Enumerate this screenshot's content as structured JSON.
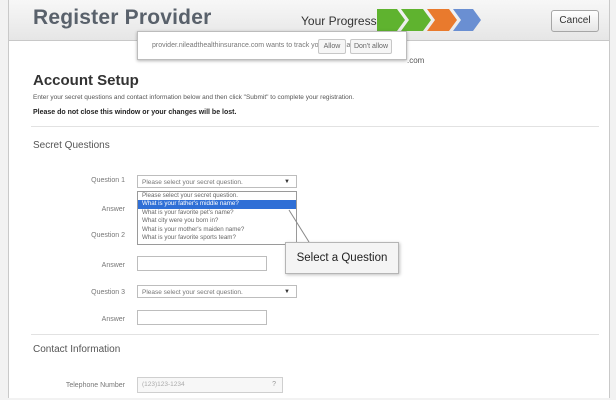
{
  "header": {
    "title": "Register Provider",
    "progress_label": "Your Progress",
    "cancel_label": "Cancel",
    "progress_colors": [
      "#5fb32f",
      "#5fb32f",
      "#e97a2d",
      "#6a8fd2"
    ]
  },
  "popup": {
    "message": "provider.nileadthealthinsurance.com wants to track your physical location.",
    "allow_label": "Allow",
    "deny_label": "Don't allow"
  },
  "email_suffix": ".com",
  "account_setup": {
    "title": "Account Setup",
    "instructions": "Enter your secret questions and contact information below and then click \"Submit\" to complete your registration.",
    "warning": "Please do not close this window or your changes will be lost."
  },
  "secret_questions": {
    "title": "Secret Questions",
    "question1_label": "Question 1",
    "question1_value": "Please select your secret question.",
    "answer1_label": "Answer",
    "question2_label": "Question 2",
    "answer2_label": "Answer",
    "question3_label": "Question 3",
    "question3_value": "Please select your secret question.",
    "answer3_label": "Answer",
    "dropdown_options": [
      "Please select your secret question.",
      "What is your father's middle name?",
      "What is your favorite pet's name?",
      "What city were you born in?",
      "What is your mother's maiden name?",
      "What is your favorite sports team?"
    ],
    "highlighted_option_index": 1,
    "callout_text": "Select a Question"
  },
  "contact_information": {
    "title": "Contact Information",
    "telephone_label": "Telephone Number",
    "telephone_placeholder": "(123)123-1234"
  }
}
